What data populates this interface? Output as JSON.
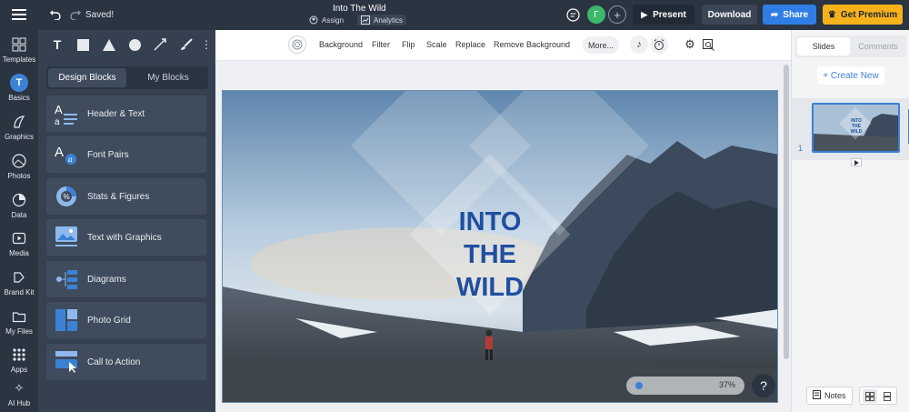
{
  "header": {
    "saved": "Saved!",
    "title": "Into The Wild",
    "assign": "Assign",
    "analytics": "Analytics",
    "avatar": "Г",
    "present": "Present",
    "download": "Download",
    "share": "Share",
    "premium": "Get Premium"
  },
  "nav": [
    {
      "label": "Templates"
    },
    {
      "label": "Basics"
    },
    {
      "label": "Graphics"
    },
    {
      "label": "Photos"
    },
    {
      "label": "Data"
    },
    {
      "label": "Media"
    },
    {
      "label": "Brand Kit"
    },
    {
      "label": "My Files"
    },
    {
      "label": "Apps"
    },
    {
      "label": "AI Hub"
    }
  ],
  "panel": {
    "tab_design": "Design Blocks",
    "tab_my": "My Blocks",
    "blocks": [
      {
        "label": "Header & Text"
      },
      {
        "label": "Font Pairs"
      },
      {
        "label": "Stats & Figures"
      },
      {
        "label": "Text with Graphics"
      },
      {
        "label": "Diagrams"
      },
      {
        "label": "Photo Grid"
      },
      {
        "label": "Call to Action"
      }
    ]
  },
  "toolbar": {
    "background": "Background",
    "filter": "Filter",
    "flip": "Flip",
    "scale": "Scale",
    "replace": "Replace",
    "remove_bg": "Remove Background",
    "more": "More..."
  },
  "slide": {
    "line1": "INTO",
    "line2": "THE",
    "line3": "WILD",
    "zoom": "37%",
    "help": "?"
  },
  "right": {
    "tab_slides": "Slides",
    "tab_comments": "Comments",
    "create_new": "+ Create New",
    "slide_number": "1",
    "thumb_text": "INTO THE WILD",
    "notes": "Notes"
  },
  "colors": {
    "topbar": "#2b3441",
    "panel": "#354150",
    "share": "#2f7ee6",
    "premium": "#f5b21a",
    "accent": "#3b82d6",
    "title_text": "#1f4fa0"
  }
}
